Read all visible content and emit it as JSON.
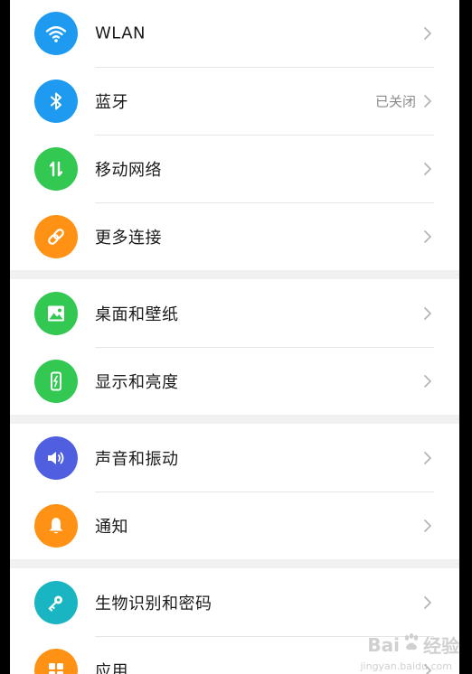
{
  "colors": {
    "wlan": "#1E9BF0",
    "bluetooth": "#1E9BF0",
    "mobile": "#32C852",
    "more": "#FF9214",
    "wallpaper": "#32C852",
    "display": "#32C852",
    "sound": "#4F5FE0",
    "notify": "#FF9214",
    "biometric": "#1AB5C3",
    "apps": "#FF9214"
  },
  "groups": [
    {
      "items": [
        {
          "label": "WLAN",
          "icon": "wifi-icon"
        },
        {
          "label": "蓝牙",
          "value": "已关闭",
          "icon": "bluetooth-icon"
        },
        {
          "label": "移动网络",
          "icon": "mobile-data-icon"
        },
        {
          "label": "更多连接",
          "icon": "link-icon"
        }
      ]
    },
    {
      "items": [
        {
          "label": "桌面和壁纸",
          "icon": "image-icon"
        },
        {
          "label": "显示和亮度",
          "icon": "phone-brightness-icon"
        }
      ]
    },
    {
      "items": [
        {
          "label": "声音和振动",
          "icon": "speaker-icon"
        },
        {
          "label": "通知",
          "icon": "bell-icon"
        }
      ]
    },
    {
      "items": [
        {
          "label": "生物识别和密码",
          "icon": "key-icon"
        },
        {
          "label": "应用",
          "icon": "apps-grid-icon"
        }
      ]
    }
  ],
  "watermark": {
    "text_left": "Bai",
    "text_right": "经验",
    "sub": "jingyan.baidu.com"
  }
}
